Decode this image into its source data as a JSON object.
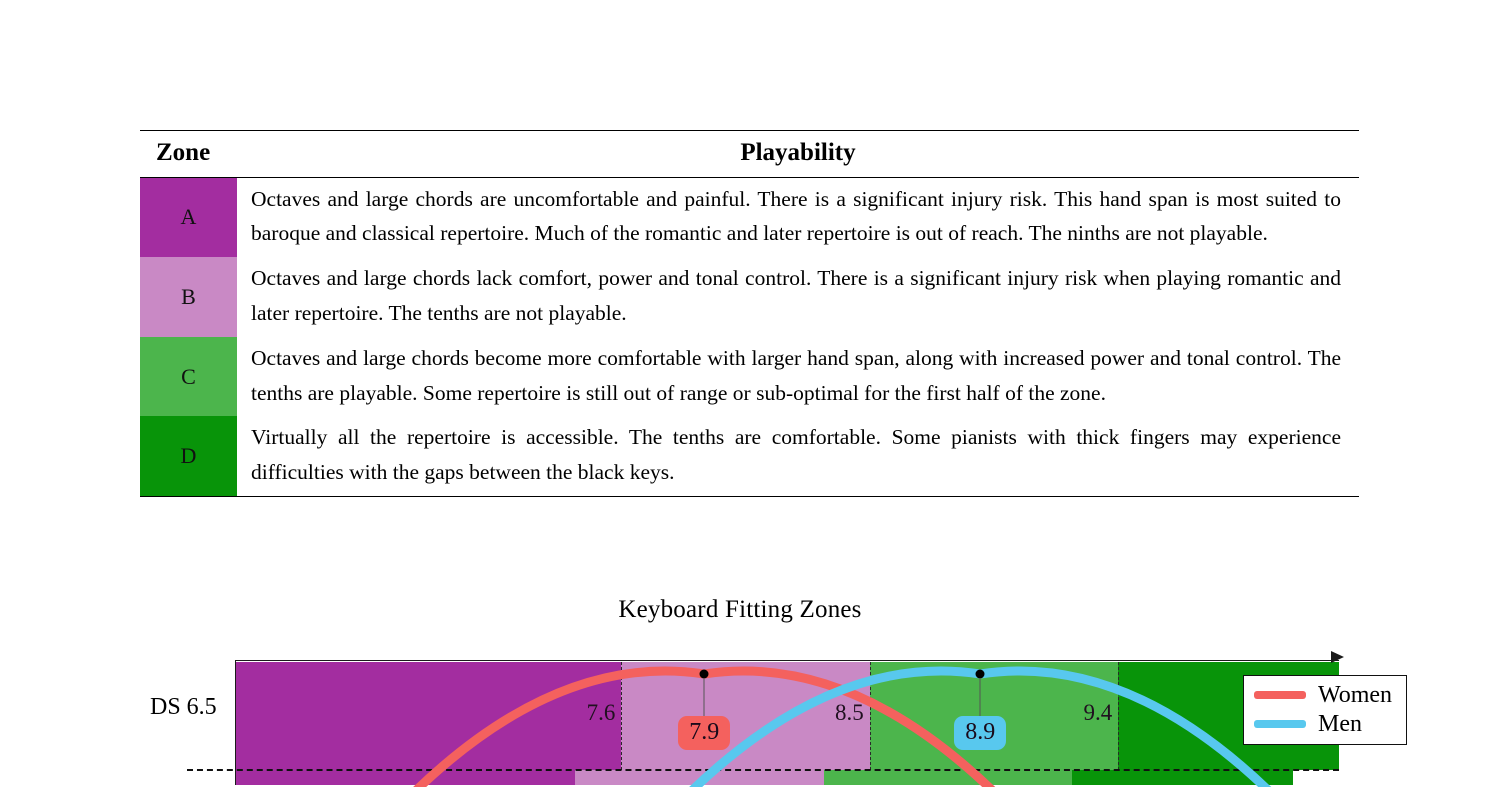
{
  "table": {
    "headers": {
      "zone": "Zone",
      "playability": "Playability"
    },
    "rows": [
      {
        "zone": "A",
        "color": "#A32DA0",
        "text": "Octaves and large chords are uncomfortable and painful. There is a significant injury risk. This hand span is most suited to baroque and classical repertoire. Much of the romantic and later repertoire is out of reach. The ninths are not playable."
      },
      {
        "zone": "B",
        "color": "#C989C5",
        "text": "Octaves and large chords lack comfort, power and tonal control. There is a significant injury risk when playing romantic and later repertoire. The tenths are not playable."
      },
      {
        "zone": "C",
        "color": "#4CB54C",
        "text": "Octaves and large chords become more comfortable with larger hand span, along with increased power and tonal control. The tenths are playable. Some repertoire is still out of range or sub-optimal for the first half of the zone."
      },
      {
        "zone": "D",
        "color": "#089409",
        "text": "Virtually all the repertoire is accessible. The tenths are comfortable. Some pianists with thick fingers may experience difficulties with the gaps between the black keys."
      }
    ]
  },
  "chart": {
    "title": "Keyboard Fitting Zones",
    "row_label": "DS 6.5",
    "legend": [
      {
        "label": "Women",
        "color": "#F4615E"
      },
      {
        "label": "Men",
        "color": "#58C8EE"
      }
    ]
  },
  "chart_data": {
    "type": "bar",
    "title": "Keyboard Fitting Zones",
    "xlabel": "",
    "ylabel": "DS 6.5",
    "grid": false,
    "legend_position": "top-right",
    "xlim": [
      6.2,
      10.2
    ],
    "zone_boundaries": [
      7.6,
      8.5,
      9.4
    ],
    "zones": [
      {
        "zone": "A",
        "color": "#A32DA0",
        "start": 6.2,
        "end": 7.6
      },
      {
        "zone": "B",
        "color": "#C989C5",
        "start": 7.6,
        "end": 8.5
      },
      {
        "zone": "C",
        "color": "#4CB54C",
        "start": 8.5,
        "end": 9.4
      },
      {
        "zone": "D",
        "color": "#089409",
        "start": 9.4,
        "end": 10.2
      }
    ],
    "tick_labels": [
      "7.6",
      "8.5",
      "9.4"
    ],
    "series": [
      {
        "name": "Women",
        "color": "#F4615E",
        "peak": 7.9,
        "peak_label": "7.9"
      },
      {
        "name": "Men",
        "color": "#58C8EE",
        "peak": 8.9,
        "peak_label": "8.9"
      }
    ]
  }
}
